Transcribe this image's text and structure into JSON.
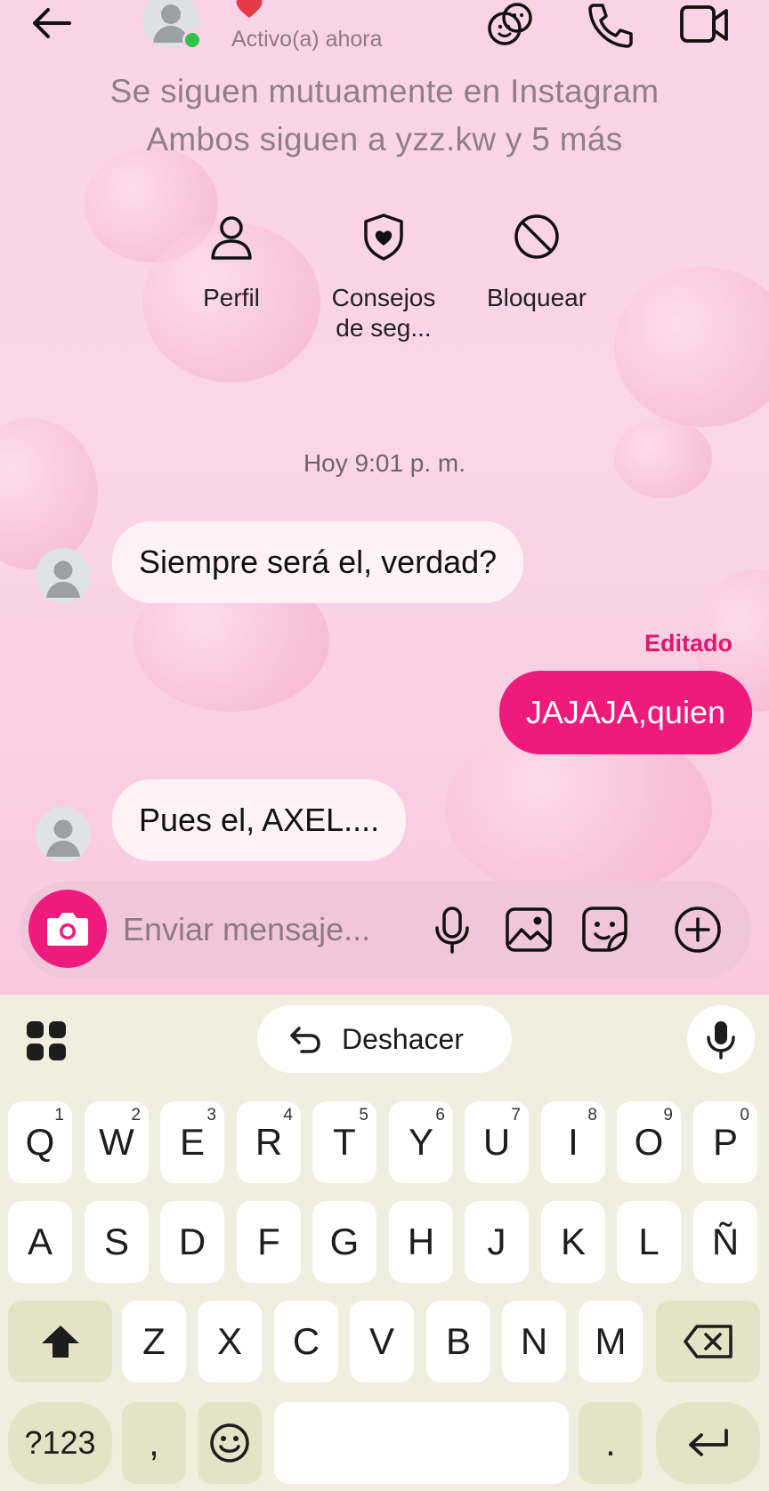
{
  "header": {
    "status": "Activo(a) ahora",
    "icons": [
      "back-arrow-icon",
      "avatar-icon",
      "heart-icon",
      "effects-icon",
      "phone-icon",
      "video-icon"
    ]
  },
  "mutual": {
    "line1": "Se siguen mutuamente en Instagram",
    "line2": "Ambos siguen a yzz.kw y 5 más"
  },
  "actions": [
    {
      "label_1": "Perfil",
      "label_2": "",
      "icon": "person-icon"
    },
    {
      "label_1": "Consejos",
      "label_2": "de seg...",
      "icon": "shield-heart-icon"
    },
    {
      "label_1": "Bloquear",
      "label_2": "",
      "icon": "block-icon"
    }
  ],
  "conversation": {
    "timestamp": "Hoy 9:01 p. m.",
    "messages": [
      {
        "from": "them",
        "text": "Siempre será el, verdad?"
      },
      {
        "from": "me",
        "text": "JAJAJA,quien",
        "meta": "Editado"
      },
      {
        "from": "them",
        "text": "Pues el, AXEL...."
      }
    ]
  },
  "composer": {
    "placeholder": "Enviar mensaje...",
    "icons": [
      "camera-icon",
      "microphone-icon",
      "gallery-icon",
      "sticker-icon",
      "add-circle-icon"
    ]
  },
  "keyboard": {
    "undo_label": "Deshacer",
    "row1": [
      {
        "k": "Q",
        "h": "1"
      },
      {
        "k": "W",
        "h": "2"
      },
      {
        "k": "E",
        "h": "3"
      },
      {
        "k": "R",
        "h": "4"
      },
      {
        "k": "T",
        "h": "5"
      },
      {
        "k": "Y",
        "h": "6"
      },
      {
        "k": "U",
        "h": "7"
      },
      {
        "k": "I",
        "h": "8"
      },
      {
        "k": "O",
        "h": "9"
      },
      {
        "k": "P",
        "h": "0"
      }
    ],
    "row2": [
      "A",
      "S",
      "D",
      "F",
      "G",
      "H",
      "J",
      "K",
      "L",
      "Ñ"
    ],
    "row3": [
      "Z",
      "X",
      "C",
      "V",
      "B",
      "N",
      "M"
    ],
    "symbols_label": "?123",
    "comma": ",",
    "period": "."
  },
  "colors": {
    "accent": "#ee1a7c",
    "chat_bg": "#fbd3e6",
    "keyboard_bg": "#efeedf",
    "online": "#31c24d"
  }
}
